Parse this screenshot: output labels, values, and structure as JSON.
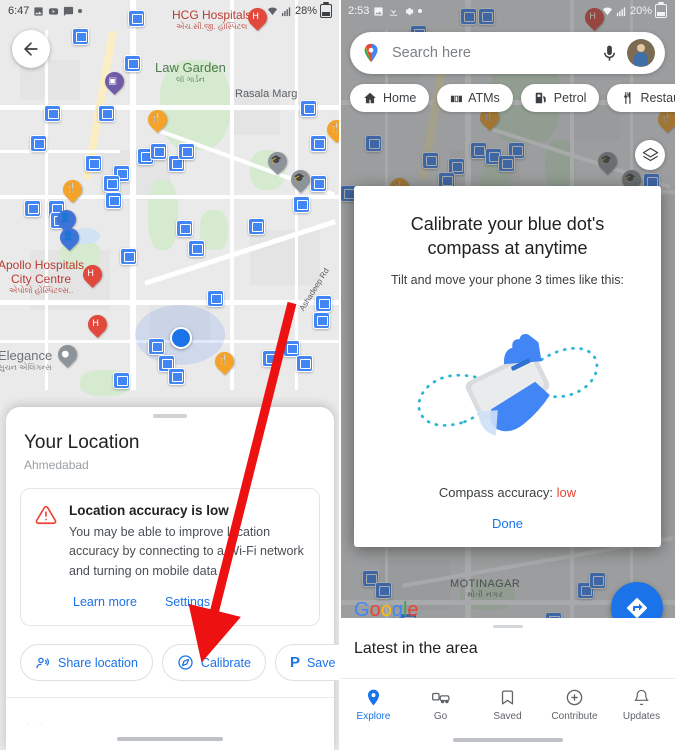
{
  "left_phone": {
    "status_bar": {
      "time": "6:47",
      "battery": "28%",
      "icons": [
        "image-icon",
        "youtube-icon",
        "message-icon",
        "dot-icon"
      ]
    },
    "back_button": "back-arrow",
    "map": {
      "labels": [
        {
          "text": "Law Garden",
          "sub": "લૉ ગાર્ડન",
          "style": "green"
        },
        {
          "text": "Rasala Marg",
          "sub": "",
          "style": "plain"
        },
        {
          "text": "Apollo Hospitals",
          "sub": "",
          "style": "red"
        },
        {
          "text": "City Centre",
          "sub": "એપોલો હોસ્પિટલ્સ..",
          "style": "red"
        },
        {
          "text": "Elegance",
          "sub": "સુચન એલિગન્સ",
          "style": "gray"
        },
        {
          "text": "Ashadeep Rd",
          "sub": "",
          "style": "rot"
        },
        {
          "text": "HCG Hospitals",
          "sub": "એચ.સી.જી. હોસ્પિટલ",
          "style": "red"
        }
      ]
    },
    "sheet": {
      "title": "Your Location",
      "subtitle": "Ahmedabad",
      "alert": {
        "icon": "warning-triangle-icon",
        "title": "Location accuracy is low",
        "body": "You may be able to improve location accuracy by connecting to a Wi-Fi network and turning on mobile data",
        "links": [
          {
            "label": "Learn more",
            "name": "learn-more-link"
          },
          {
            "label": "Settings",
            "name": "settings-link"
          }
        ]
      },
      "chips": [
        {
          "label": "Share location",
          "icon": "share-location-icon"
        },
        {
          "label": "Calibrate",
          "icon": "compass-icon"
        },
        {
          "label": "Save parki",
          "icon": "parking-p-icon"
        }
      ]
    }
  },
  "right_phone": {
    "status_bar": {
      "time": "2:53",
      "battery": "20%",
      "icons": [
        "image-icon",
        "download-icon",
        "settings-icon",
        "dot-icon"
      ]
    },
    "search": {
      "placeholder": "Search here",
      "logo": "google-maps-pin-icon",
      "mic": "microphone-icon",
      "avatar": "user-avatar"
    },
    "category_chips": [
      {
        "label": "Home",
        "icon": "home-icon"
      },
      {
        "label": "ATMs",
        "icon": "atm-icon"
      },
      {
        "label": "Petrol",
        "icon": "fuel-pump-icon"
      },
      {
        "label": "Restaurant",
        "icon": "restaurant-icon"
      }
    ],
    "layers_button": "layers-icon",
    "directions_fab": "directions-icon",
    "google_logo": [
      "G",
      "o",
      "o",
      "g",
      "l",
      "e"
    ],
    "map": {
      "labels": [
        {
          "text": "MOTINAGAR",
          "sub": "મોતી નગર"
        }
      ]
    },
    "dialog": {
      "title": "Calibrate your blue dot's compass at anytime",
      "subtitle": "Tilt and move your phone 3 times like this:",
      "animation": "hand-holding-phone-figure-eight",
      "accuracy_label": "Compass accuracy:",
      "accuracy_value": "low",
      "done_label": "Done"
    },
    "latest_sheet": {
      "title": "Latest in the area"
    },
    "bottom_nav": [
      {
        "label": "Explore",
        "icon": "map-pin-icon",
        "active": true
      },
      {
        "label": "Go",
        "icon": "commute-icon",
        "active": false
      },
      {
        "label": "Saved",
        "icon": "bookmark-icon",
        "active": false
      },
      {
        "label": "Contribute",
        "icon": "plus-circle-icon",
        "active": false
      },
      {
        "label": "Updates",
        "icon": "bell-icon",
        "active": false
      }
    ]
  },
  "annotation": {
    "arrow": "red-arrow-pointing-to-calibrate",
    "color": "#ee1111"
  }
}
